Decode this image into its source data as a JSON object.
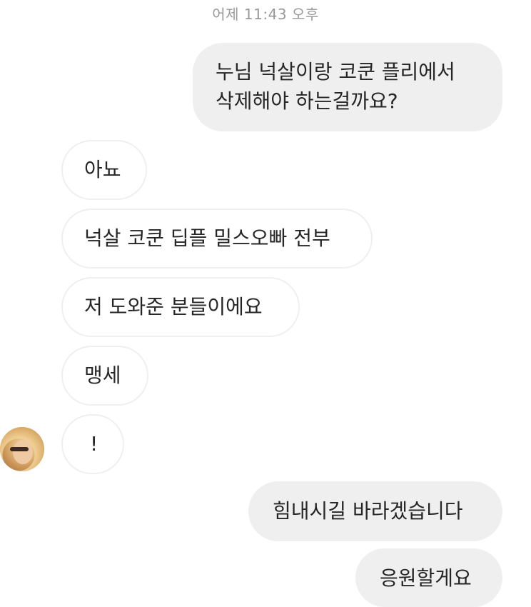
{
  "chat": {
    "timestamp": "어제 11:43 오후",
    "messages": [
      {
        "direction": "sent",
        "lines": [
          "누님 넉살이랑 코쿤 플리에서",
          "삭제해야 하는걸까요?"
        ]
      },
      {
        "direction": "received",
        "text": "아뇨"
      },
      {
        "direction": "received",
        "text": "넉살 코쿤 딥플 밀스오빠 전부"
      },
      {
        "direction": "received",
        "text": "저 도와준 분들이에요"
      },
      {
        "direction": "received",
        "text": "맹세"
      },
      {
        "direction": "received",
        "text": "!"
      },
      {
        "direction": "sent",
        "text": "힘내시길 바라겠습니다"
      },
      {
        "direction": "sent",
        "text": "응원할게요"
      }
    ]
  },
  "colors": {
    "sent_bubble": "#efefef",
    "received_border": "#efefef",
    "text": "#262626",
    "timestamp": "#999999"
  }
}
